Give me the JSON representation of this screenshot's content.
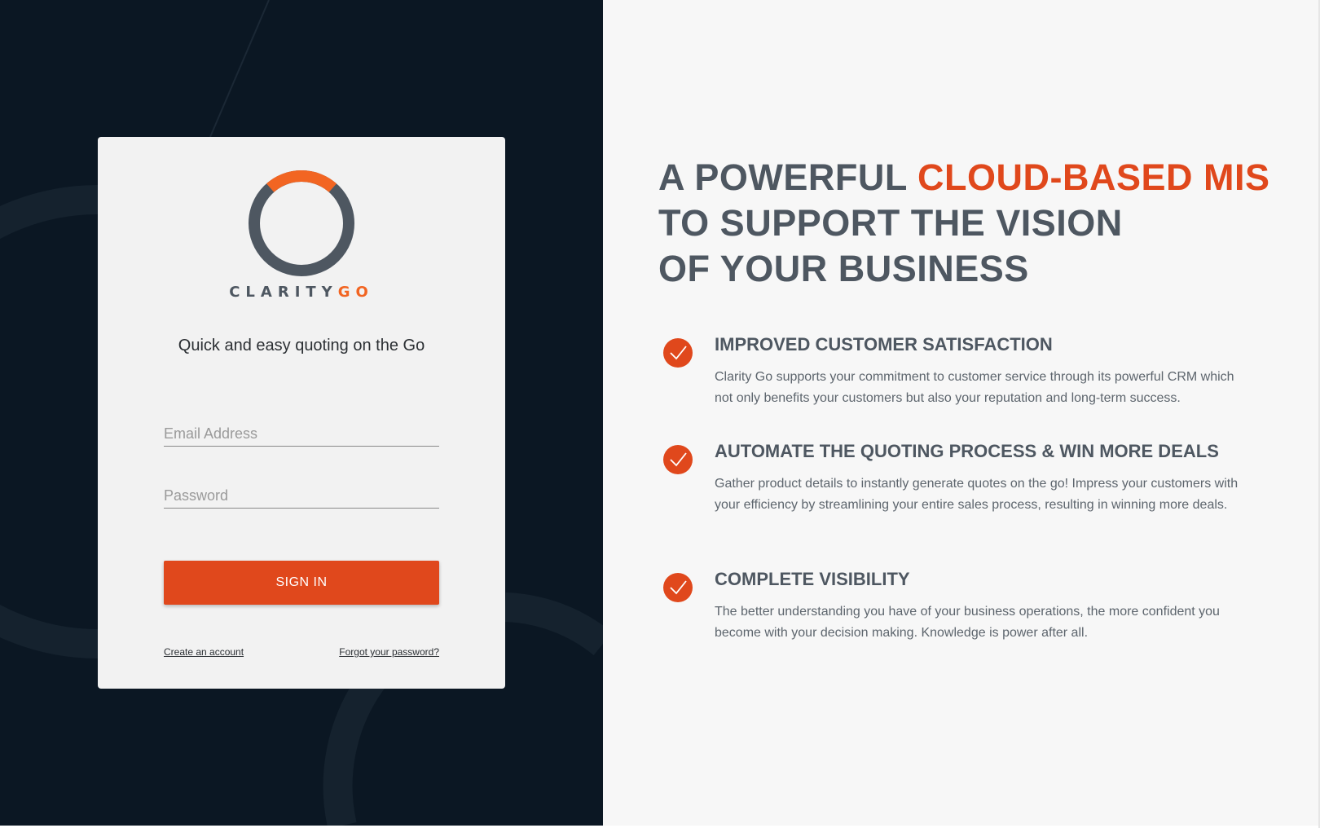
{
  "login": {
    "brand_primary": "CLARITY",
    "brand_accent": "GO",
    "tagline": "Quick and easy quoting on the Go",
    "email_placeholder": "Email Address",
    "email_value": "",
    "password_placeholder": "Password",
    "password_value": "",
    "signin_label": "SIGN IN",
    "create_account_label": "Create an account",
    "forgot_password_label": "Forgot your password?"
  },
  "hero": {
    "line1_plain": "A POWERFUL ",
    "line1_accent": "CLOUD-BASED MIS",
    "line2": "TO SUPPORT THE VISION",
    "line3": "OF YOUR BUSINESS"
  },
  "features": [
    {
      "icon": "check-circle-icon",
      "title": "IMPROVED CUSTOMER SATISFACTION",
      "description": "Clarity Go supports your commitment to customer service through its powerful CRM which not only benefits your customers but also your reputation and long-term success."
    },
    {
      "icon": "check-circle-icon",
      "title": "AUTOMATE THE QUOTING PROCESS & WIN MORE DEALS",
      "description": "Gather product details to instantly generate quotes on the go! Impress your customers with your efficiency by streamlining your entire sales process, resulting in winning more deals."
    },
    {
      "icon": "check-circle-icon",
      "title": "COMPLETE VISIBILITY",
      "description": "The better understanding you have of your business operations, the more confident you become with your decision making. Knowledge is power after all."
    }
  ],
  "colors": {
    "accent": "#e0481c",
    "logo_orange": "#f26522",
    "dark_panel": "#0b1723",
    "text_gray": "#4e5761"
  }
}
